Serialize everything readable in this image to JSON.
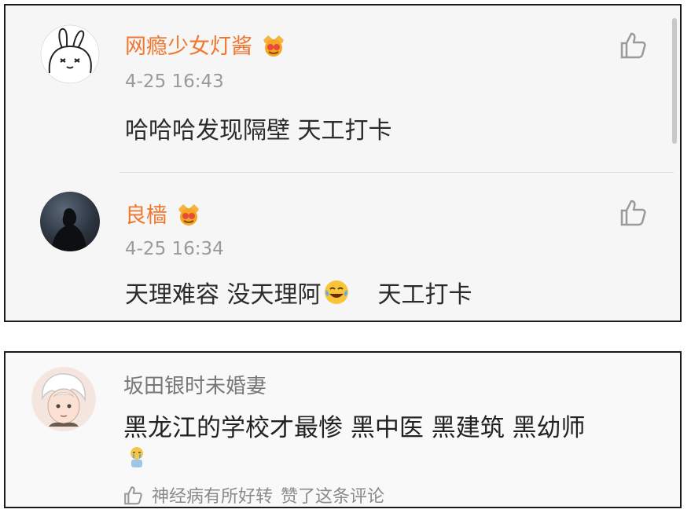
{
  "comments_top": [
    {
      "username": "网瘾少女灯酱",
      "timestamp": "4-25 16:43",
      "text": "哈哈哈发现隔壁 天工打卡",
      "avatar": "white-bunny-avatar"
    },
    {
      "username": "良樯",
      "timestamp": "4-25 16:34",
      "text_part1": "天理难容 没天理阿",
      "emoji": "laughing-tears-emoji",
      "text_part2": "天工打卡",
      "avatar": "dark-silhouette-avatar"
    }
  ],
  "comment_bottom": {
    "username": "坂田银时未婚妻",
    "text": "黑龙江的学校才最惨 黑中医 黑建筑 黑幼师",
    "emoji": "crying-figure-emoji",
    "like_user": "神经病有所好转",
    "like_action": "赞了这条评论",
    "avatar": "anime-boy-avatar"
  },
  "colors": {
    "username_accent": "#f0772f",
    "timestamp": "#9a9a9a",
    "panel_bg": "#f6f6f6"
  },
  "icons": [
    "thumbs-up-icon",
    "vip-crown-badge-icon"
  ]
}
